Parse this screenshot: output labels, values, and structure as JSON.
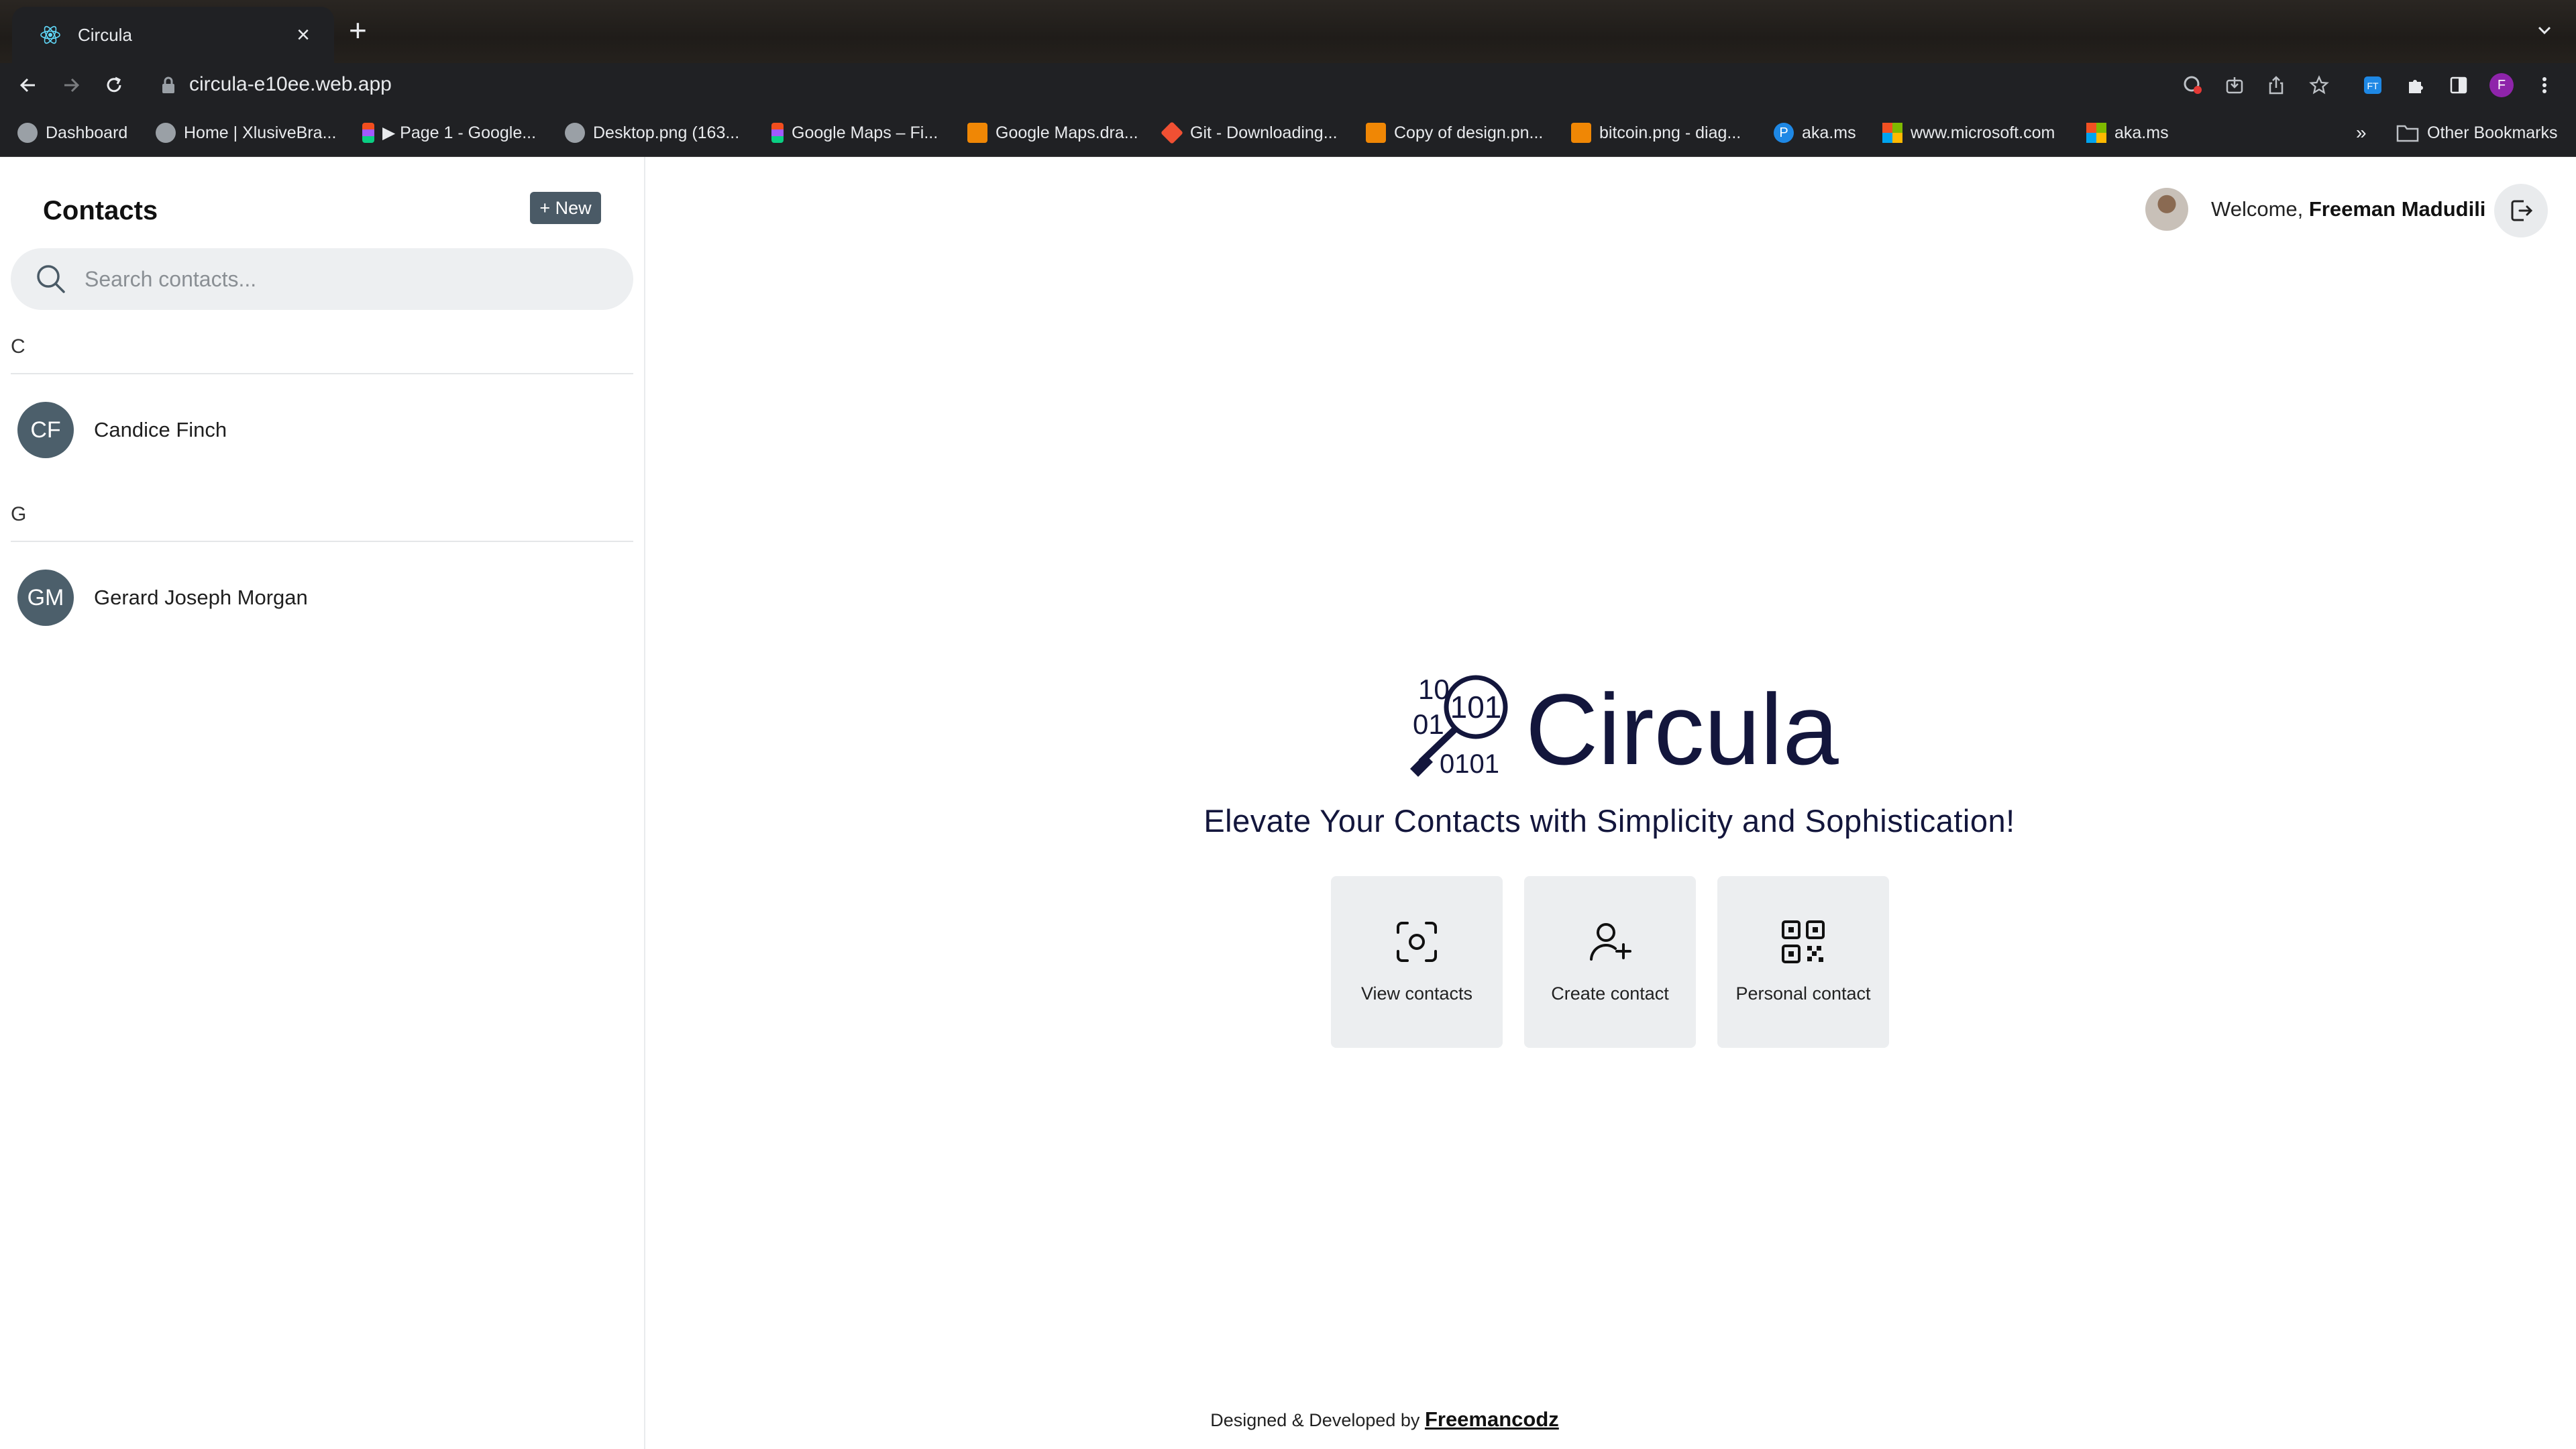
{
  "browser": {
    "tab_title": "Circula",
    "url": "circula-e10ee.web.app",
    "profile_initial": "F",
    "bookmarks": [
      {
        "label": "Dashboard",
        "icon": "globe-icon"
      },
      {
        "label": "Home | XlusiveBra...",
        "icon": "globe-icon"
      },
      {
        "label": "▶ Page 1 - Google...",
        "icon": "figma-icon"
      },
      {
        "label": "Desktop.png (163...",
        "icon": "globe-icon"
      },
      {
        "label": "Google Maps – Fi...",
        "icon": "figma-icon"
      },
      {
        "label": "Google Maps.dra...",
        "icon": "drawio-icon"
      },
      {
        "label": "Git - Downloading...",
        "icon": "git-icon"
      },
      {
        "label": "Copy of design.pn...",
        "icon": "drawio-icon"
      },
      {
        "label": "bitcoin.png - diag...",
        "icon": "drawio-icon"
      },
      {
        "label": "aka.ms",
        "icon": "p-icon"
      },
      {
        "label": "www.microsoft.com",
        "icon": "microsoft-icon"
      },
      {
        "label": "aka.ms",
        "icon": "microsoft-icon"
      }
    ],
    "more_label": "»",
    "other_bookmarks": "Other Bookmarks"
  },
  "sidebar": {
    "title": "Contacts",
    "new_button": "+ New",
    "search_placeholder": "Search contacts...",
    "groups": [
      {
        "letter": "C",
        "contacts": [
          {
            "initials": "CF",
            "name": "Candice Finch"
          }
        ]
      },
      {
        "letter": "G",
        "contacts": [
          {
            "initials": "GM",
            "name": "Gerard Joseph Morgan"
          }
        ]
      }
    ]
  },
  "header": {
    "welcome_prefix": "Welcome,",
    "user_name": "Freeman Madudili"
  },
  "hero": {
    "logo_word": "Circula",
    "logo_bits": [
      "10",
      "01",
      "101",
      "0101"
    ],
    "tagline": "Elevate Your Contacts with Simplicity and Sophistication!"
  },
  "actions": [
    {
      "label": "View contacts",
      "icon": "scan-icon"
    },
    {
      "label": "Create contact",
      "icon": "user-plus-icon"
    },
    {
      "label": "Personal contact",
      "icon": "qr-code-icon"
    }
  ],
  "footer": {
    "text": "Designed & Developed by",
    "link": "Freemancodz"
  },
  "colors": {
    "brand_navy": "#13163c",
    "avatar_bg": "#4c5f6b",
    "new_button_bg": "#4a5a66",
    "card_bg": "#eceef0"
  }
}
